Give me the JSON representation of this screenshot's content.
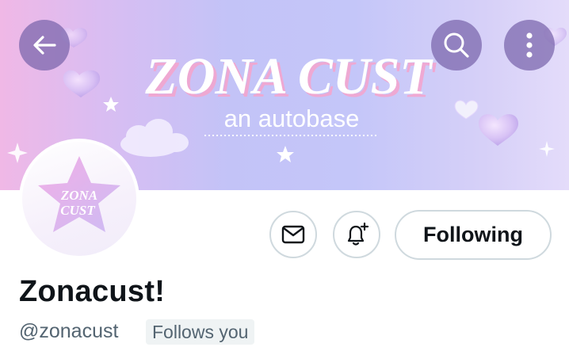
{
  "header": {
    "banner_title": "ZONA CUST",
    "banner_subtitle": "an autobase",
    "back_icon": "arrow-left-icon",
    "search_icon": "search-icon",
    "more_icon": "more-vertical-icon"
  },
  "avatar": {
    "text_line1": "ZONA",
    "text_line2": "CUST"
  },
  "actions": {
    "message_icon": "envelope-icon",
    "notify_icon": "bell-plus-icon",
    "following_label": "Following"
  },
  "profile": {
    "display_name": "Zonacust!",
    "handle": "@zonacust",
    "follows_you": "Follows you"
  },
  "colors": {
    "accent_text": "#0f1419",
    "secondary_text": "#536471",
    "border": "#cfd9de",
    "badge_bg": "#eff3f4"
  }
}
